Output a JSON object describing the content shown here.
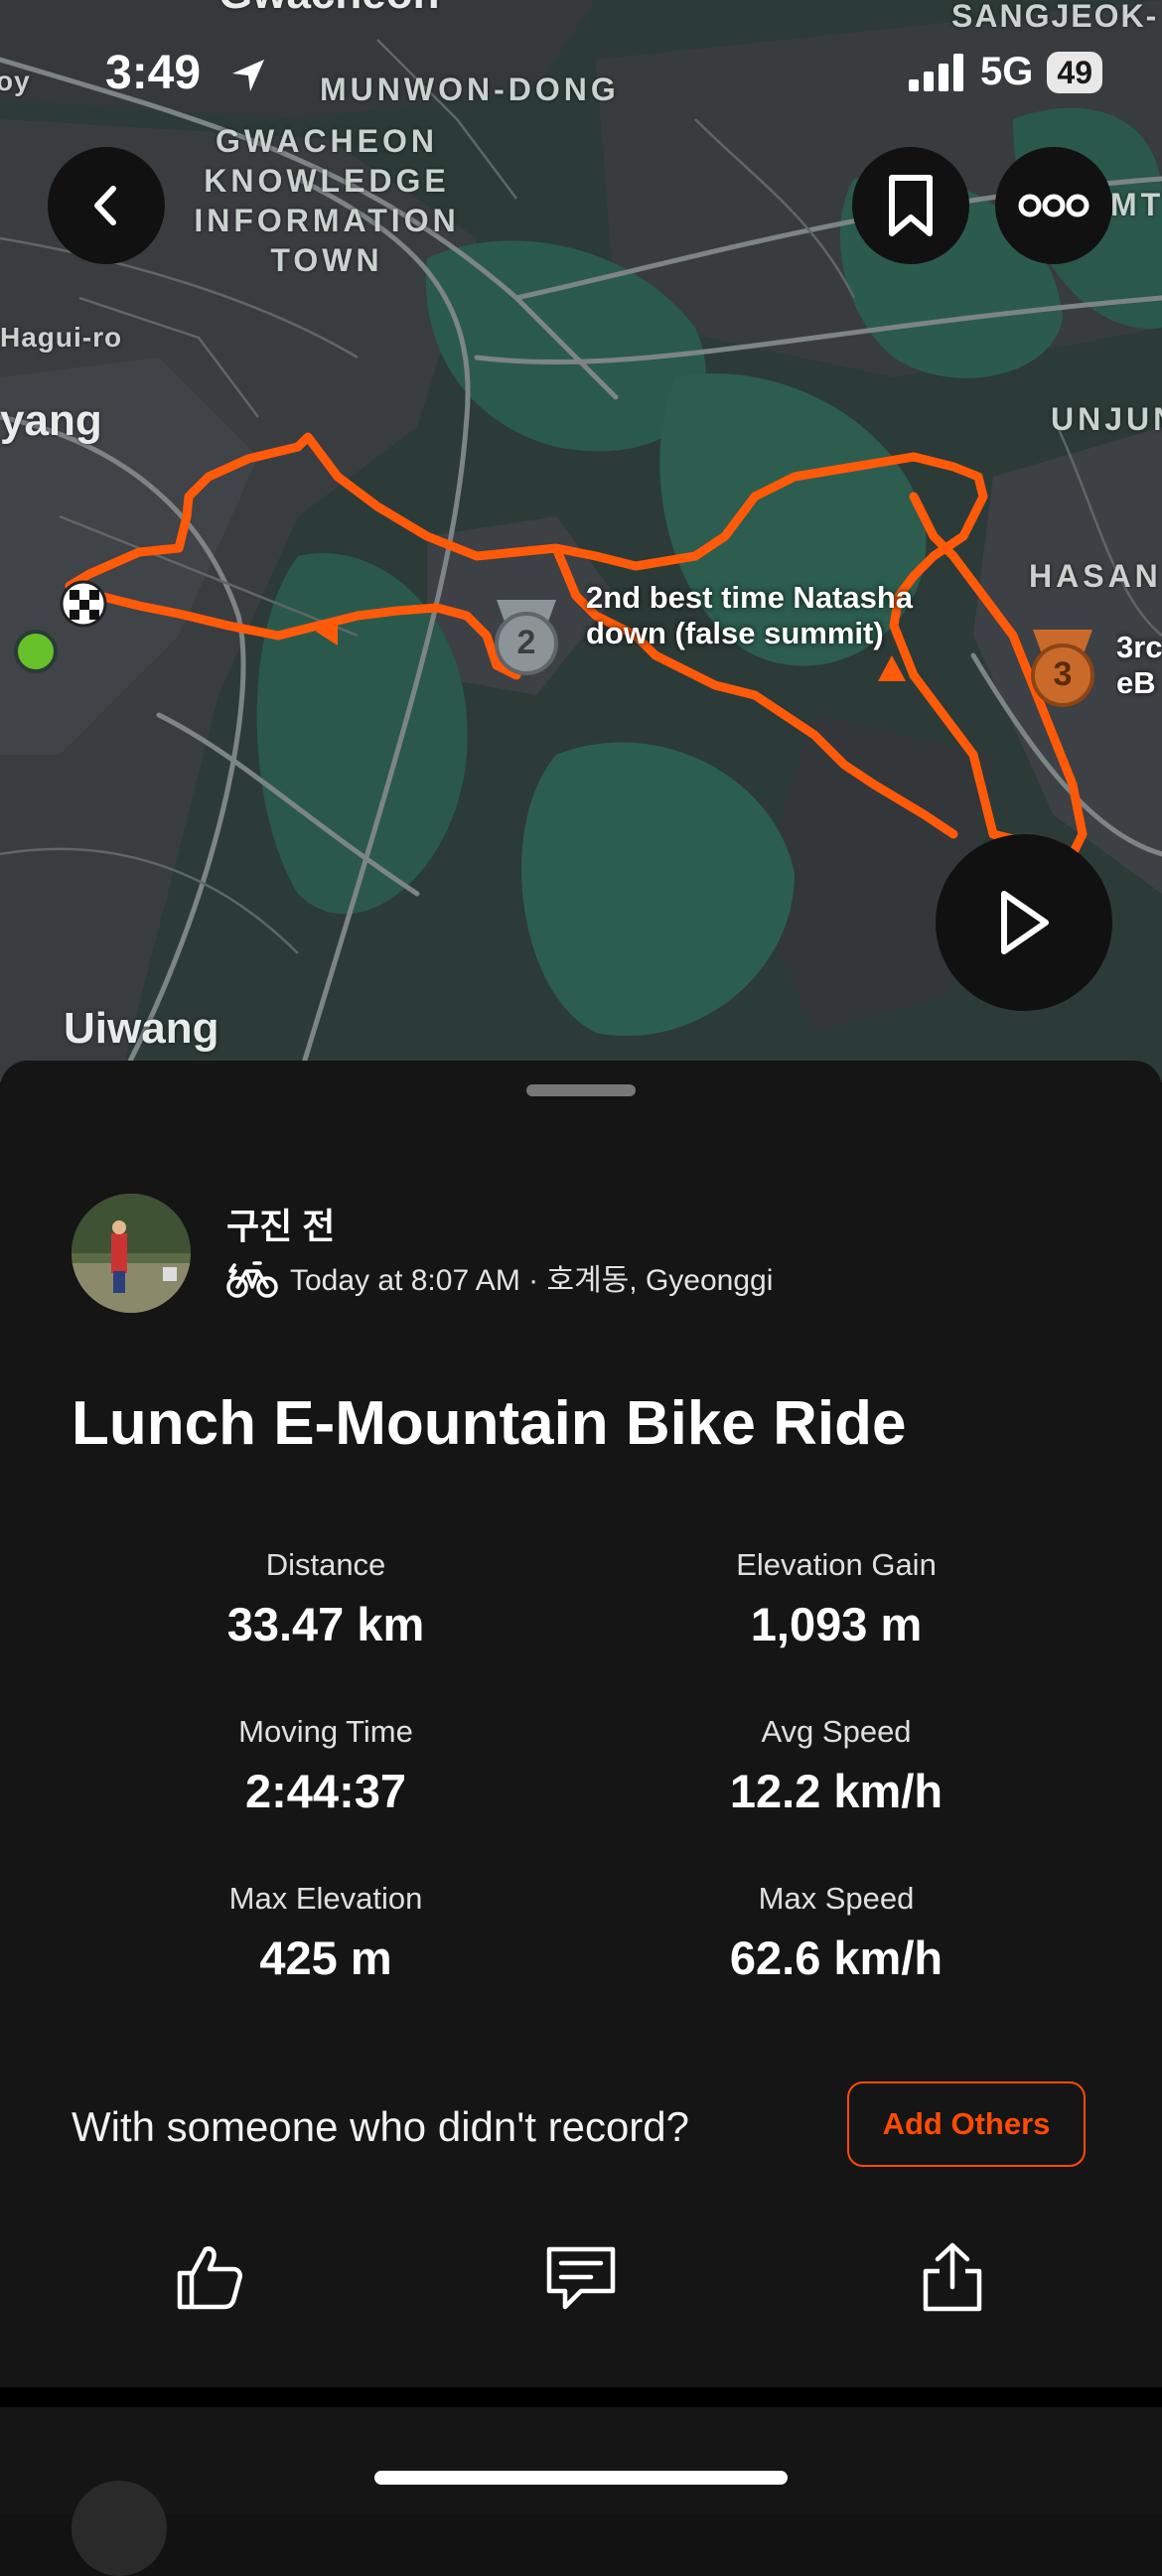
{
  "status_bar": {
    "time": "3:49",
    "network": "5G",
    "battery": "49"
  },
  "map": {
    "labels": {
      "top_partial": "Gwacheon",
      "sangjeok": "SANGJEOK-",
      "munwon": "MUNWON-DONG",
      "gwacheon_knowledge": "GWACHEON KNOWLEDGE INFORMATION TOWN",
      "hagui": "Hagui-ro",
      "anyang": "yang",
      "unjung": "UNJUN",
      "hasan": "HASAN",
      "uiwang": "Uiwang",
      "left_edge": "oy",
      "right_edge_top": "MT"
    },
    "segments": [
      {
        "rank": "2",
        "text": "2nd best time Natasha down (false summit)"
      },
      {
        "rank": "3",
        "text": "3rc eB"
      }
    ]
  },
  "activity": {
    "athlete": "구진 전",
    "meta": "Today at 8:07 AM · 호계동, Gyeonggi",
    "title": "Lunch E-Mountain Bike Ride",
    "stats": [
      {
        "label": "Distance",
        "value": "33.47 km"
      },
      {
        "label": "Elevation Gain",
        "value": "1,093 m"
      },
      {
        "label": "Moving Time",
        "value": "2:44:37"
      },
      {
        "label": "Avg Speed",
        "value": "12.2 km/h"
      },
      {
        "label": "Max Elevation",
        "value": "425 m"
      },
      {
        "label": "Max Speed",
        "value": "62.6 km/h"
      }
    ],
    "with_prompt": "With someone who didn't record?",
    "add_others": "Add Others"
  },
  "colors": {
    "accent": "#fc4c02",
    "route": "#ff5a0a",
    "bronze": "#c96a2a",
    "silver": "#8d9497"
  }
}
